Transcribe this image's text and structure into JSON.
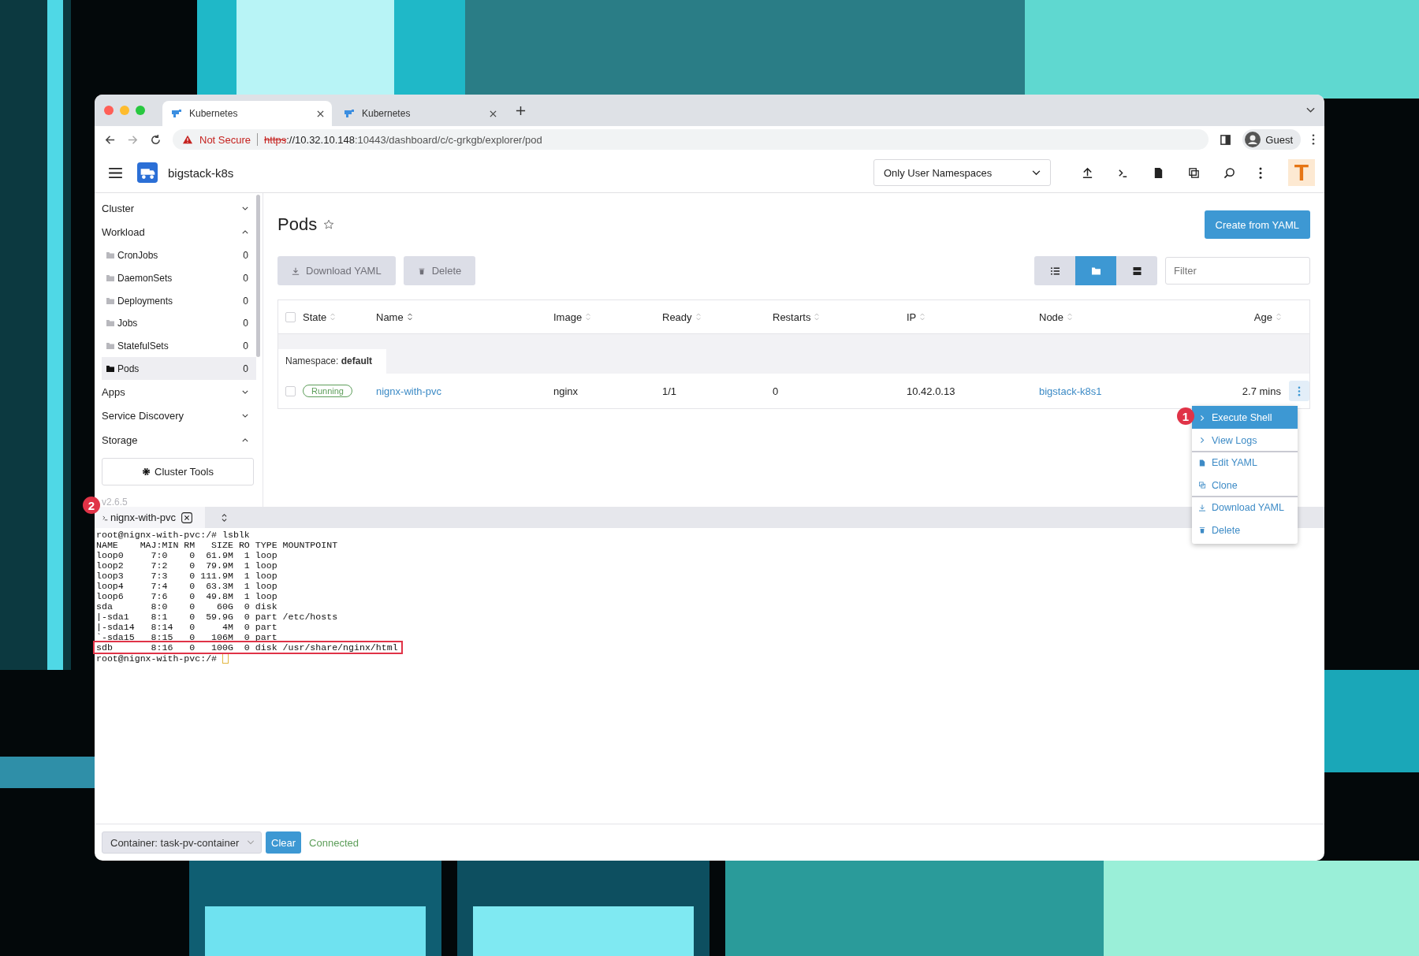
{
  "browser": {
    "tabs": [
      {
        "title": "Kubernetes",
        "selected": true
      },
      {
        "title": "Kubernetes",
        "selected": false
      }
    ],
    "address": {
      "warning": "Not Secure",
      "scheme": "https",
      "host": "://10.32.10.148",
      "path": ":10443/dashboard/c/c-grkgb/explorer/pod"
    },
    "profile": "Guest"
  },
  "header": {
    "cluster": "bigstack-k8s",
    "namespace_select": "Only User Namespaces",
    "avatar": "T"
  },
  "sidebar": {
    "groups": [
      {
        "label": "Cluster",
        "expanded": false
      },
      {
        "label": "Workload",
        "expanded": true,
        "children": [
          {
            "label": "CronJobs",
            "count": "0",
            "selected": false
          },
          {
            "label": "DaemonSets",
            "count": "0",
            "selected": false
          },
          {
            "label": "Deployments",
            "count": "0",
            "selected": false
          },
          {
            "label": "Jobs",
            "count": "0",
            "selected": false
          },
          {
            "label": "StatefulSets",
            "count": "0",
            "selected": false
          },
          {
            "label": "Pods",
            "count": "0",
            "selected": true
          }
        ]
      },
      {
        "label": "Apps",
        "expanded": false
      },
      {
        "label": "Service Discovery",
        "expanded": false
      },
      {
        "label": "Storage",
        "expanded": true
      }
    ],
    "cluster_tools": "Cluster Tools",
    "version": "v2.6.5"
  },
  "page": {
    "title": "Pods",
    "create_button": "Create from YAML",
    "actions": [
      {
        "label": "Download YAML",
        "kind": "download",
        "disabled": true
      },
      {
        "label": "Delete",
        "kind": "trash",
        "disabled": true
      }
    ],
    "view_modes": [
      {
        "kind": "list",
        "selected": false
      },
      {
        "kind": "folder",
        "selected": true
      },
      {
        "kind": "rows",
        "selected": false
      }
    ],
    "filter": {
      "placeholder": "Filter"
    },
    "table": {
      "select_all_checked": false,
      "columns": [
        "State",
        "Name",
        "Image",
        "Ready",
        "Restarts",
        "IP",
        "Node",
        "Age"
      ],
      "group": "Namespace: **default**",
      "rows": [
        {
          "checked": false,
          "state": "Running",
          "name": "nignx-with-pvc",
          "image": "nginx",
          "ready": "1/1",
          "restarts": "0",
          "ip": "10.42.0.13",
          "node": "bigstack-k8s1",
          "age": "2.7 mins"
        }
      ]
    }
  },
  "context_menu": [
    {
      "label": "Execute Shell",
      "kind": "chevron",
      "selected": true,
      "divider_before": false
    },
    {
      "label": "View Logs",
      "kind": "chevron",
      "selected": false,
      "divider_before": false
    },
    {
      "label": "Edit YAML",
      "kind": "file",
      "selected": false,
      "divider_before": true
    },
    {
      "label": "Clone",
      "kind": "clone",
      "selected": false,
      "divider_before": false
    },
    {
      "label": "Download YAML",
      "kind": "download",
      "selected": false,
      "divider_before": true
    },
    {
      "label": "Delete",
      "kind": "trash",
      "selected": false,
      "divider_before": false
    }
  ],
  "callouts": [
    "1",
    "2"
  ],
  "terminal": {
    "tab": "nignx-with-pvc",
    "lines": [
      {
        "text": "root@nignx-with-pvc:/# lsblk",
        "highlighted": false
      },
      {
        "text": "NAME    MAJ:MIN RM   SIZE RO TYPE MOUNTPOINT",
        "highlighted": false
      },
      {
        "text": "loop0     7:0    0  61.9M  1 loop",
        "highlighted": false
      },
      {
        "text": "loop2     7:2    0  79.9M  1 loop",
        "highlighted": false
      },
      {
        "text": "loop3     7:3    0 111.9M  1 loop",
        "highlighted": false
      },
      {
        "text": "loop4     7:4    0  63.3M  1 loop",
        "highlighted": false
      },
      {
        "text": "loop6     7:6    0  49.8M  1 loop",
        "highlighted": false
      },
      {
        "text": "sda       8:0    0    60G  0 disk",
        "highlighted": false
      },
      {
        "text": "|-sda1    8:1    0  59.9G  0 part /etc/hosts",
        "highlighted": false
      },
      {
        "text": "|-sda14   8:14   0     4M  0 part",
        "highlighted": false
      },
      {
        "text": "`-sda15   8:15   0   106M  0 part",
        "highlighted": false
      },
      {
        "text": "sdb       8:16   0   100G  0 disk /usr/share/nginx/html",
        "highlighted": true
      }
    ],
    "prompt": "root@nignx-with-pvc:/#"
  },
  "footer": {
    "container": "Container: task-pv-container",
    "clear": "Clear",
    "status": "Connected"
  }
}
